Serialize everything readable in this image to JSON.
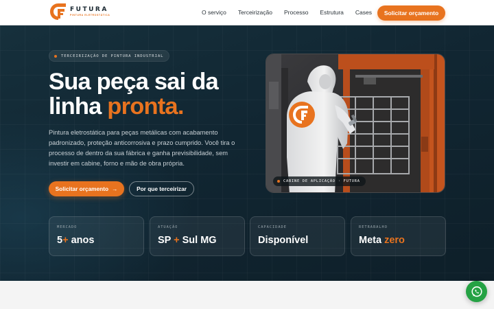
{
  "brand": {
    "name": "FUTURA",
    "tagline": "PINTURA ELETROSTÁTICA",
    "accent_color": "#e8731f"
  },
  "nav": {
    "items": [
      "O serviço",
      "Terceirização",
      "Processo",
      "Estrutura",
      "Cases"
    ],
    "cta_label": "Solicitar orçamento"
  },
  "hero": {
    "badge": "TERCEIRIZAÇÃO DE PINTURA INDUSTRIAL",
    "title_line1": "Sua peça sai da",
    "title_line2_plain": "linha ",
    "title_line2_accent": "pronta.",
    "description": "Pintura eletrostática para peças metálicas com acabamento padronizado, proteção anticorrosiva e prazo cumprido. Você tira o processo de dentro da sua fábrica e ganha previsibilidade, sem investir em cabine, forno e mão de obra própria.",
    "primary_button": "Solicitar orçamento",
    "primary_button_arrow": "→",
    "secondary_button": "Por que terceirizar",
    "photo_caption": "CABINE DE APLICAÇÃO · FUTURA"
  },
  "stats": [
    {
      "label": "MERCADO",
      "value_a": "5",
      "value_accent": "+",
      "value_b": " anos"
    },
    {
      "label": "ATUAÇÃO",
      "value_a": "SP ",
      "value_accent": "+",
      "value_b": " Sul MG"
    },
    {
      "label": "CAPACIDADE",
      "value_a": "Disponível",
      "value_accent": "",
      "value_b": ""
    },
    {
      "label": "RETRABALHO",
      "value_a": "Meta ",
      "value_accent": "zero",
      "value_b": ""
    }
  ],
  "colors": {
    "hero_bg": "#112632",
    "whatsapp": "#25a244"
  },
  "icons": {
    "whatsapp": "whatsapp-icon",
    "logo": "futura-logo-icon"
  }
}
